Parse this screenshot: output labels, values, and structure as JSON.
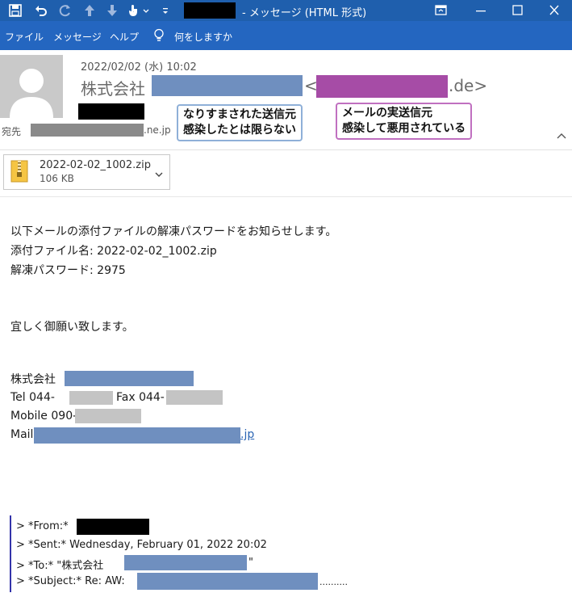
{
  "titlebar": {
    "title": "- メッセージ (HTML 形式)",
    "bg_color": "#1f5fad",
    "icons": [
      "save-icon",
      "undo-icon",
      "redo-icon",
      "up-arrow-icon",
      "down-arrow-icon",
      "touch-mode-icon",
      "customize-dropdown-icon",
      "restore-ribbon-icon",
      "minimize-icon",
      "maximize-icon",
      "close-icon"
    ]
  },
  "menu": {
    "bg_color": "#2466c0",
    "items": [
      "ファイル",
      "メッセージ",
      "ヘルプ"
    ],
    "tell_me": "何をしますか"
  },
  "header": {
    "date": "2022/02/02 (水) 10:02",
    "sender_company_prefix": "株式会社",
    "sender_email_open": "<",
    "sender_email_domain": ".de>",
    "to_label": "宛先",
    "to_domain": ".ne.jp"
  },
  "callouts": {
    "left": [
      "なりすまされた送信元",
      "感染したとは限らない"
    ],
    "right": [
      "メールの実送信元",
      "感染して悪用されている"
    ],
    "left_border": "#8fb0d8",
    "right_border": "#c070c0"
  },
  "attachment": {
    "name": "2022-02-02_1002.zip",
    "size": "106 KB"
  },
  "body": {
    "line1": "以下メールの添付ファイルの解凍パスワードをお知らせします。",
    "line2": "添付ファイル名: 2022-02-02_1002.zip",
    "line3": "解凍パスワード: 2975",
    "greeting": "宜しく御願い致します。",
    "sig_company": "株式会社",
    "sig_tel": "Tel 044-",
    "sig_fax": "Fax 044-",
    "sig_mobile": "Mobile 090-",
    "sig_mail": "Mail",
    "sig_mail_suffix": ".jp"
  },
  "quote": {
    "from": "> *From:*",
    "sent": "> *Sent:* Wednesday, February 01, 2022 20:02",
    "to_prefix": "> *To:* \"株式会社",
    "to_suffix": "\"",
    "subject": "> *Subject:* Re: AW:",
    "subject_suffix": "..........",
    "bar_color": "#3333aa"
  },
  "redaction_colors": {
    "blue": "#6f8fbf",
    "purple": "#a64ca6",
    "black": "#000000",
    "gray": "#c4c4c4"
  }
}
